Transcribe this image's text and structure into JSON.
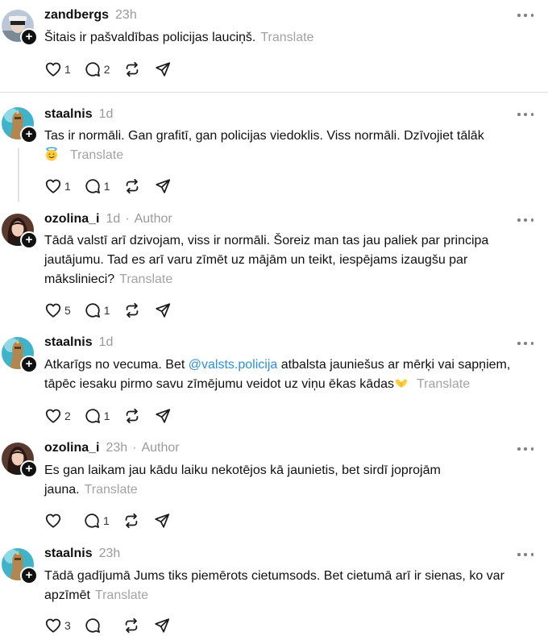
{
  "comments": [
    {
      "username": "zandbergs",
      "time": "23h",
      "author_tag": "",
      "text": "Šitais ir pašvaldības policijas lauciņš.",
      "translate": "Translate",
      "likes": "1",
      "replies": "2"
    },
    {
      "username": "staalnis",
      "time": "1d",
      "author_tag": "",
      "text": "Tas ir normāli. Gan grafitī, gan policijas viedoklis. Viss normāli. Dzīvojiet tālāk",
      "emoji": "smiling-face-with-halo",
      "translate": "Translate",
      "likes": "1",
      "replies": "1"
    },
    {
      "username": "ozolina_i",
      "time": "1d",
      "author_tag": "Author",
      "text": "Tādā valstī arī dzivojam, viss ir normāli. Šoreiz man tas jau paliek par principa jautājumu. Tad es arī varu zīmēt uz mājām un teikt, iespējams izaugšu par mākslinieci?",
      "translate": "Translate",
      "likes": "5",
      "replies": "1"
    },
    {
      "username": "staalnis",
      "time": "1d",
      "author_tag": "",
      "text_before": "Atkarīgs no vecuma. Bet",
      "mention": "@valsts.policija",
      "text_after": "atbalsta jauniešus ar mērķi vai sapņiem, tāpēc iesaku pirmo savu zīmējumu veidot uz viņu ēkas kādas",
      "emoji": "heart-hands",
      "translate": "Translate",
      "likes": "2",
      "replies": "1"
    },
    {
      "username": "ozolina_i",
      "time": "23h",
      "author_tag": "Author",
      "text": "Es gan laikam jau kādu laiku nekotējos kā jaunietis, bet sirdī joprojām jauna.",
      "translate": "Translate",
      "likes": "",
      "replies": "1"
    },
    {
      "username": "staalnis",
      "time": "23h",
      "author_tag": "",
      "text": "Tādā gadījumā Jums tiks piemērots cietumsods. Bet cietumā arī ir sienas, ko var apzīmēt",
      "translate": "Translate",
      "likes": "3",
      "replies": ""
    }
  ],
  "separator": "·",
  "icons": {
    "like": "heart-outline-icon",
    "reply": "speech-bubble-icon",
    "repost": "repost-arrows-icon",
    "share": "paper-plane-icon",
    "more": "three-dots-icon",
    "follow": "plus-icon"
  }
}
